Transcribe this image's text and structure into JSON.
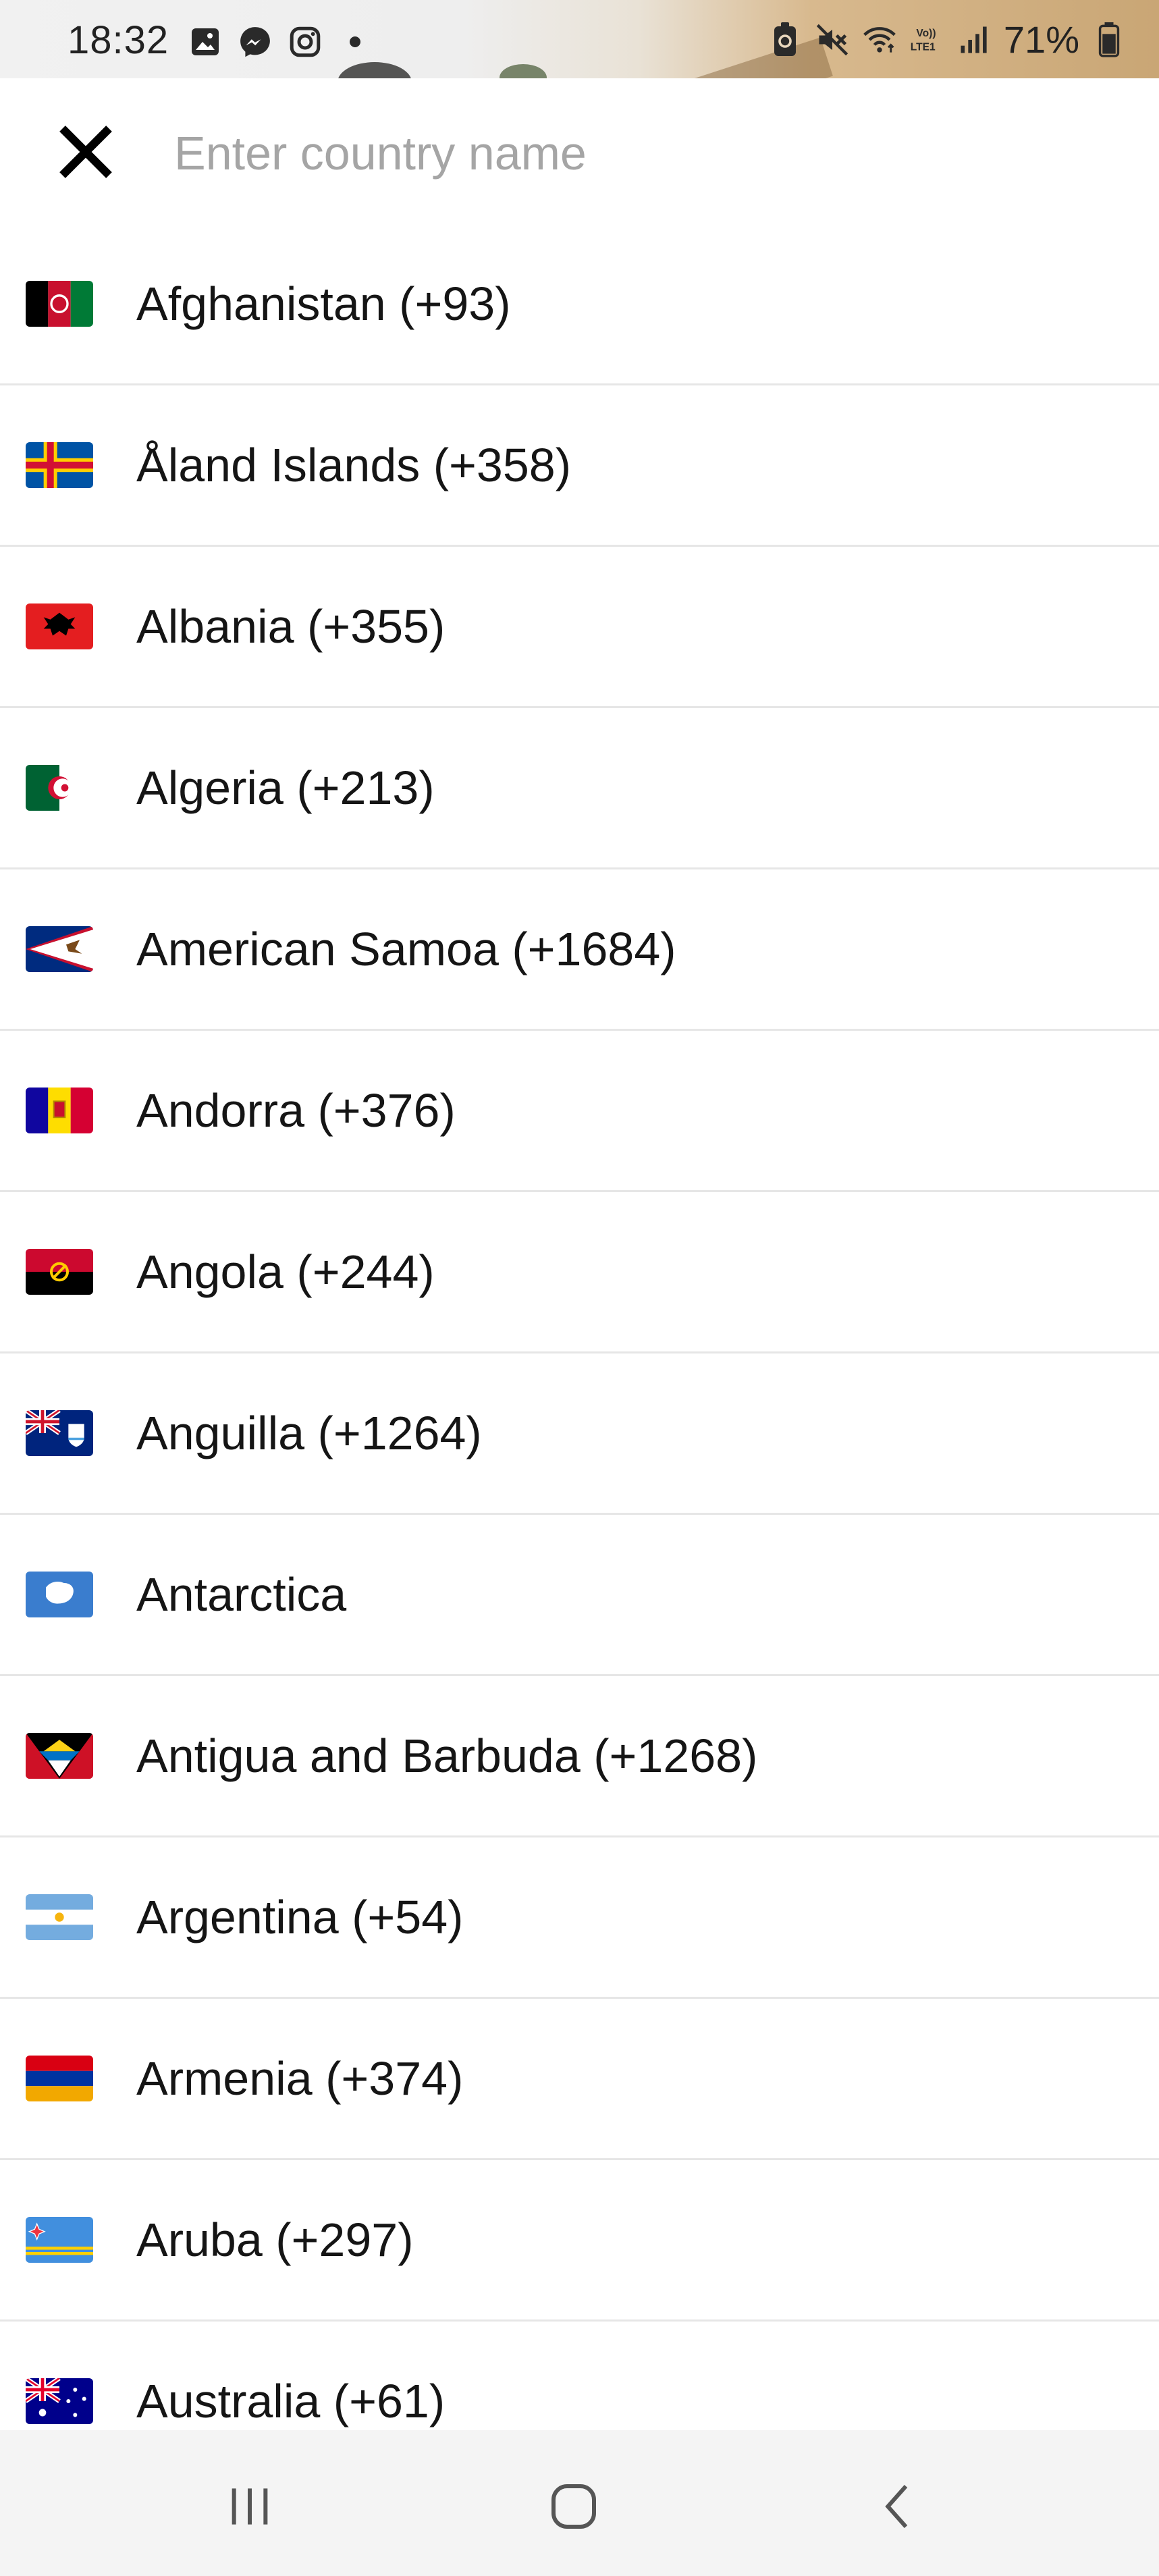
{
  "status_bar": {
    "time": "18:32",
    "battery_percent": "71%",
    "left_icons": [
      "gallery-icon",
      "messenger-icon",
      "instagram-icon",
      "dot-icon"
    ],
    "right_icons": [
      "battery-saver-icon",
      "mute-icon",
      "wifi-icon",
      "volte-icon",
      "signal-icon",
      "battery-icon"
    ]
  },
  "search": {
    "placeholder": "Enter country name",
    "value": "",
    "close_icon": "close-icon"
  },
  "countries": [
    {
      "label": "Afghanistan (+93)",
      "flag_name": "flag-afghanistan"
    },
    {
      "label": "Åland Islands (+358)",
      "flag_name": "flag-aland-islands"
    },
    {
      "label": "Albania (+355)",
      "flag_name": "flag-albania"
    },
    {
      "label": "Algeria (+213)",
      "flag_name": "flag-algeria"
    },
    {
      "label": "American Samoa (+1684)",
      "flag_name": "flag-american-samoa"
    },
    {
      "label": "Andorra (+376)",
      "flag_name": "flag-andorra"
    },
    {
      "label": "Angola (+244)",
      "flag_name": "flag-angola"
    },
    {
      "label": "Anguilla (+1264)",
      "flag_name": "flag-anguilla"
    },
    {
      "label": "Antarctica",
      "flag_name": "flag-antarctica"
    },
    {
      "label": "Antigua and Barbuda (+1268)",
      "flag_name": "flag-antigua-and-barbuda"
    },
    {
      "label": "Argentina (+54)",
      "flag_name": "flag-argentina"
    },
    {
      "label": "Armenia (+374)",
      "flag_name": "flag-armenia"
    },
    {
      "label": "Aruba (+297)",
      "flag_name": "flag-aruba"
    },
    {
      "label": "Australia (+61)",
      "flag_name": "flag-australia"
    }
  ],
  "nav_bar": {
    "buttons": [
      "recent-apps-icon",
      "home-icon",
      "back-icon"
    ]
  }
}
